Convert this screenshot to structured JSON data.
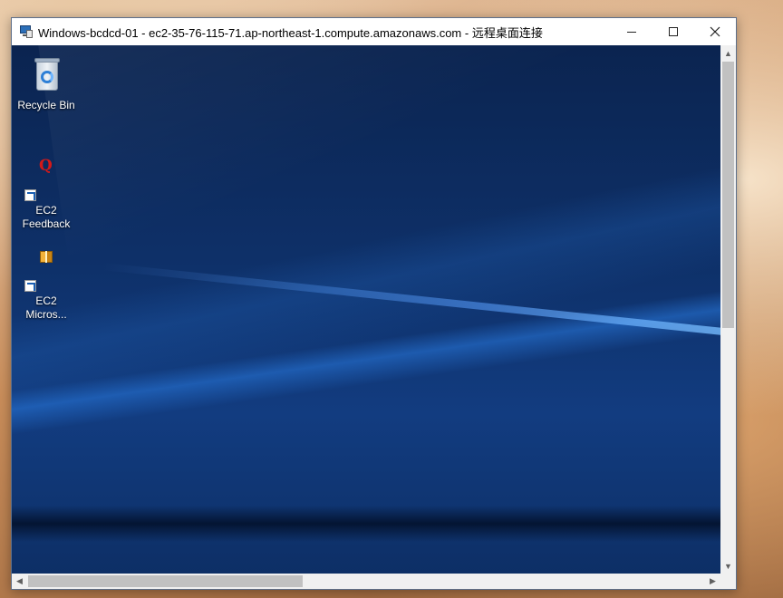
{
  "window": {
    "title": "Windows-bcdcd-01 - ec2-35-76-115-71.ap-northeast-1.compute.amazonaws.com - 远程桌面连接",
    "app_icon": "remote-desktop-icon",
    "controls": {
      "minimize_icon": "minimize-icon",
      "maximize_icon": "maximize-icon",
      "close_icon": "close-icon"
    }
  },
  "desktop": {
    "icons": [
      {
        "label": "Recycle Bin",
        "icon": "recycle-bin-icon"
      },
      {
        "label_line1": "EC2",
        "label_line2": "Feedback",
        "icon": "feedback-icon",
        "shortcut": true
      },
      {
        "label_line1": "EC2",
        "label_line2": "Micros...",
        "icon": "package-icon",
        "shortcut": true
      }
    ]
  },
  "scrollbars": {
    "vertical": {
      "up_arrow": "▲",
      "down_arrow": "▼"
    },
    "horizontal": {
      "left_arrow": "◀",
      "right_arrow": "▶"
    }
  },
  "colors": {
    "desktop_background": "#0e3068",
    "window_frame": "#ffffff",
    "scrollbar_thumb": "#c1c1c1"
  }
}
